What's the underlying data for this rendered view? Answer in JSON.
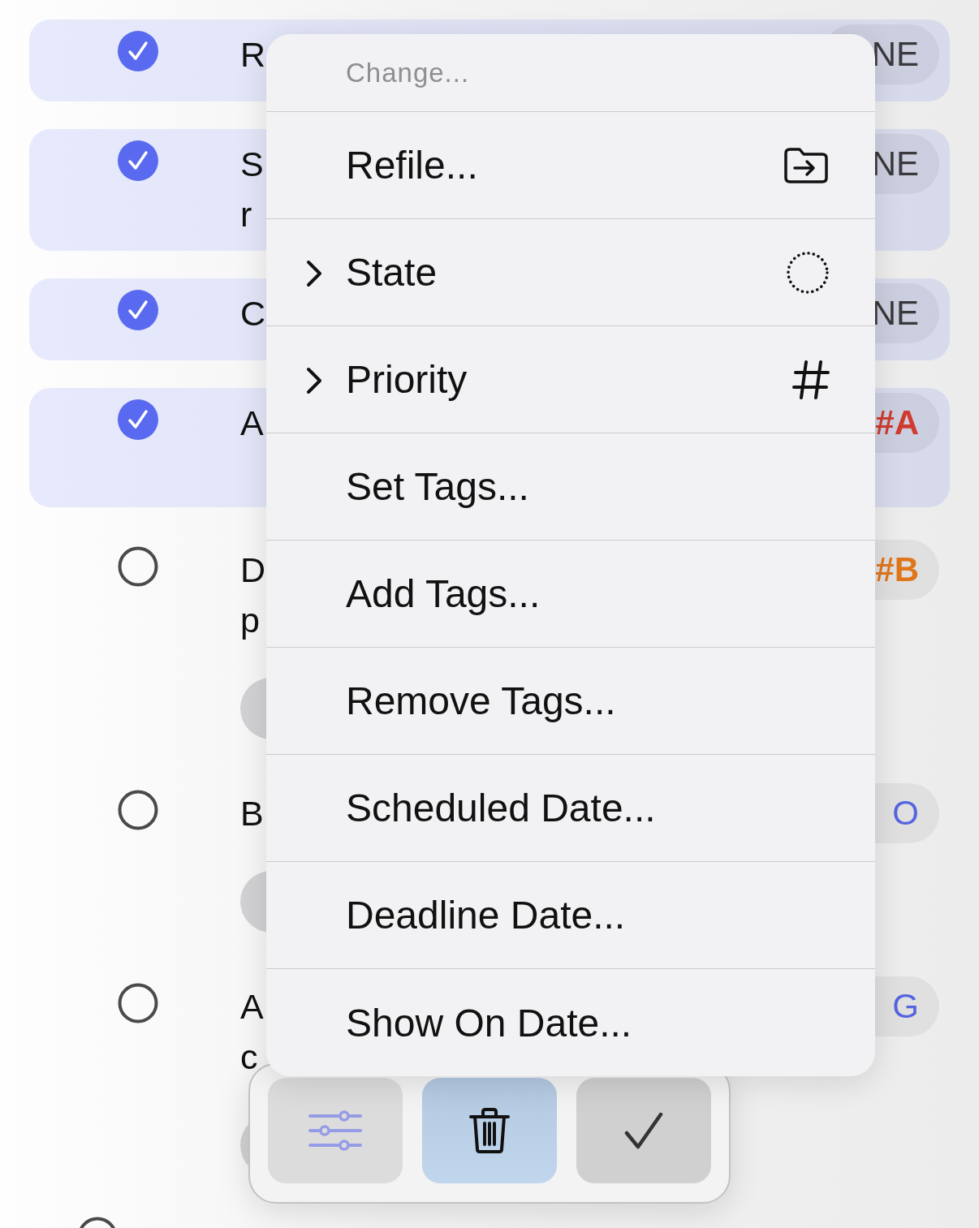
{
  "rows": [
    {
      "kind": "item",
      "selected": true,
      "lines": [
        "R"
      ],
      "tag": {
        "text": "NE",
        "kind": "keyword",
        "color": "#3a3a3c"
      }
    },
    {
      "kind": "wrapped",
      "selected": true,
      "lines": [
        "S",
        "r"
      ],
      "tag": {
        "text": "NE",
        "kind": "keyword",
        "color": "#3a3a3c"
      }
    },
    {
      "kind": "item",
      "selected": true,
      "lines": [
        "C"
      ],
      "tag": {
        "text": "NE",
        "kind": "keyword",
        "color": "#3a3a3c"
      }
    },
    {
      "kind": "wrapped",
      "selected": true,
      "lines": [
        "A"
      ],
      "tag": {
        "text": "#A",
        "kind": "priority",
        "color": "#d13b2f"
      }
    },
    {
      "kind": "wrapped",
      "selected": false,
      "lines": [
        "D",
        "p"
      ],
      "tag": {
        "text": "#B",
        "kind": "priority",
        "color": "#e0761c"
      },
      "pill": true
    },
    {
      "kind": "item",
      "selected": false,
      "lines": [
        "B"
      ],
      "tag": {
        "text": "O",
        "kind": "keyword",
        "color": "#5565e0"
      },
      "pill": true
    },
    {
      "kind": "wrapped",
      "selected": false,
      "lines": [
        "A",
        "c"
      ],
      "tag": {
        "text": "G",
        "kind": "keyword",
        "color": "#5565e0"
      },
      "pill": true
    },
    {
      "kind": "outdented",
      "selected": false,
      "lines": []
    }
  ],
  "menu": {
    "header": "Change...",
    "items": [
      {
        "label": "Refile...",
        "kind": "action"
      },
      {
        "label": "State",
        "kind": "submenu"
      },
      {
        "label": "Priority",
        "kind": "submenu"
      },
      {
        "label": "Set Tags...",
        "kind": "action"
      },
      {
        "label": "Add Tags...",
        "kind": "action"
      },
      {
        "label": "Remove Tags...",
        "kind": "action"
      },
      {
        "label": "Scheduled Date...",
        "kind": "action"
      },
      {
        "label": "Deadline Date...",
        "kind": "action"
      },
      {
        "label": "Show On Date...",
        "kind": "action"
      }
    ]
  },
  "toolbar": {
    "buttons": [
      {
        "selected": false
      },
      {
        "selected": true
      },
      {
        "selected": false
      }
    ]
  }
}
